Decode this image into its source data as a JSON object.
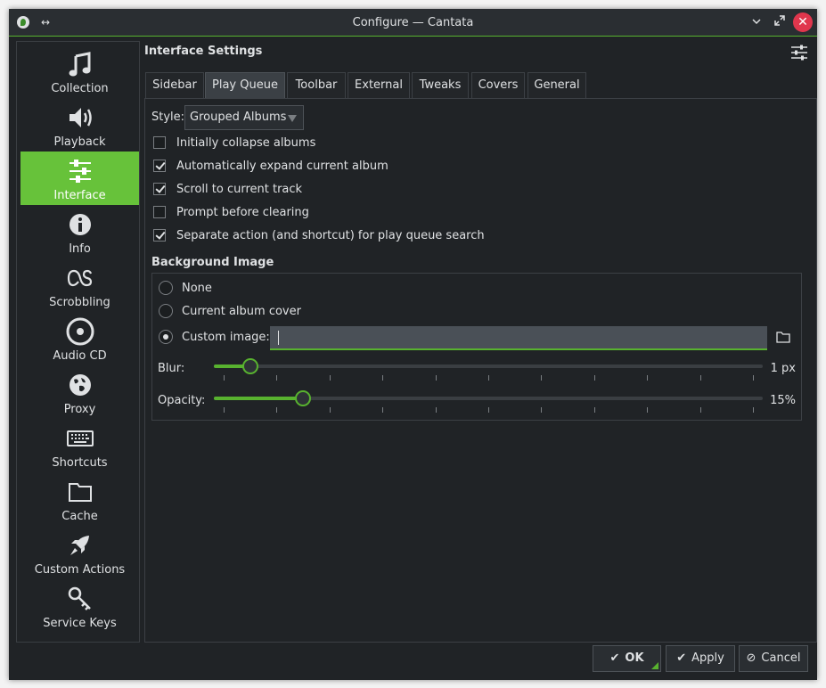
{
  "window": {
    "title": "Configure — Cantata"
  },
  "titlebar": {
    "close_glyph": "✕",
    "minimize_glyph": "⌄",
    "maximize_glyph": "⤡",
    "pin_glyph": "↔"
  },
  "sidebar": {
    "items": [
      {
        "label": "Collection",
        "icon": "music-note-icon"
      },
      {
        "label": "Playback",
        "icon": "speaker-icon"
      },
      {
        "label": "Interface",
        "icon": "sliders-icon",
        "active": true
      },
      {
        "label": "Info",
        "icon": "info-icon"
      },
      {
        "label": "Scrobbling",
        "icon": "lastfm-icon"
      },
      {
        "label": "Audio CD",
        "icon": "cd-icon"
      },
      {
        "label": "Proxy",
        "icon": "globe-icon"
      },
      {
        "label": "Shortcuts",
        "icon": "keyboard-icon"
      },
      {
        "label": "Cache",
        "icon": "folder-icon"
      },
      {
        "label": "Custom Actions",
        "icon": "rocket-icon"
      },
      {
        "label": "Service Keys",
        "icon": "key-icon"
      }
    ]
  },
  "page": {
    "title": "Interface Settings"
  },
  "tabs": [
    {
      "label": "Sidebar"
    },
    {
      "label": "Play Queue",
      "active": true
    },
    {
      "label": "Toolbar"
    },
    {
      "label": "External"
    },
    {
      "label": "Tweaks"
    },
    {
      "label": "Covers"
    },
    {
      "label": "General"
    }
  ],
  "style": {
    "label": "Style:",
    "value": "Grouped Albums"
  },
  "options": [
    {
      "label": "Initially collapse albums",
      "checked": false
    },
    {
      "label": "Automatically expand current album",
      "checked": true
    },
    {
      "label": "Scroll to current track",
      "checked": true
    },
    {
      "label": "Prompt before clearing",
      "checked": false
    },
    {
      "label": "Separate action (and shortcut) for play queue search",
      "checked": true
    }
  ],
  "background": {
    "title": "Background Image",
    "radios": [
      {
        "label": "None",
        "checked": false
      },
      {
        "label": "Current album cover",
        "checked": false
      },
      {
        "label": "Custom image:",
        "checked": true
      }
    ],
    "custom_image_value": "",
    "blur": {
      "label": "Blur:",
      "value_text": "1 px",
      "fraction": 0.067
    },
    "opacity": {
      "label": "Opacity:",
      "value_text": "15%",
      "fraction": 0.162
    }
  },
  "buttons": {
    "ok": "OK",
    "apply": "Apply",
    "cancel": "Cancel"
  },
  "colors": {
    "accent": "#58b22f",
    "active_sidebar": "#67c23a",
    "background": "#202326"
  }
}
